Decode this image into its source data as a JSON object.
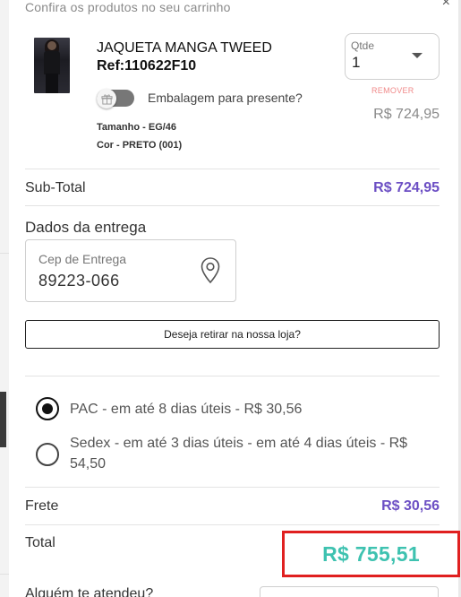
{
  "header": {
    "text": "Confira os produtos no seu carrinho"
  },
  "product": {
    "name": "JAQUETA MANGA TWEED",
    "ref": "Ref:110622F10",
    "gift_label": "Embalagem para presente?",
    "gift_toggle_on": false,
    "size": "Tamanho - EG/46",
    "color": "Cor - PRETO (001)",
    "qty_label": "Qtde",
    "qty_value": "1",
    "remove_label": "REMOVER",
    "price": "R$ 724,95"
  },
  "subtotal": {
    "label": "Sub-Total",
    "value": "R$ 724,95"
  },
  "delivery": {
    "title": "Dados da entrega",
    "cep_label": "Cep de Entrega",
    "cep_value": "89223-066",
    "store_pickup_label": "Deseja retirar na nossa loja?"
  },
  "shipping_options": [
    {
      "label": "PAC - em até 8 dias úteis - R$ 30,56",
      "selected": true
    },
    {
      "label_line1": "Sedex - em até 3 dias úteis - em até 4 dias úteis - R$",
      "label_line2": "54,50",
      "selected": false
    }
  ],
  "freight": {
    "label": "Frete",
    "value": "R$ 30,56"
  },
  "total": {
    "label": "Total",
    "value": "R$ 755,51"
  },
  "help": {
    "label": "Alguém te atendeu?"
  },
  "colors": {
    "purple": "#6c4fc4",
    "teal": "#3ec2b0",
    "highlight_red": "#e02020"
  }
}
